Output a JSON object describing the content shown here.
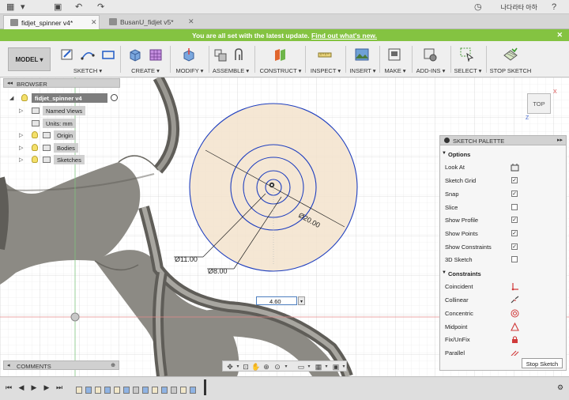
{
  "titlebar": {
    "user_name": "나다라타 아하",
    "help_label": "?"
  },
  "tabs": [
    {
      "label": "fidjet_spinner v4*",
      "active": true
    },
    {
      "label": "BusanU_fidjet v5*",
      "active": false
    }
  ],
  "notice": {
    "text": "You are all set with the latest update.",
    "link": "Find out what's new.",
    "close": "✕",
    "color": "#84c341"
  },
  "toolbar": {
    "workspace": "MODEL ▾",
    "groups": [
      "SKETCH ▾",
      "CREATE ▾",
      "MODIFY ▾",
      "ASSEMBLE ▾",
      "CONSTRUCT ▾",
      "INSPECT ▾",
      "INSERT ▾",
      "MAKE ▾",
      "ADD-INS ▾",
      "SELECT ▾",
      "STOP SKETCH"
    ]
  },
  "browser": {
    "title": "BROWSER",
    "root": "fidjet_spinner v4",
    "items": [
      "Named Views",
      "Units: mm",
      "Origin",
      "Bodies",
      "Sketches"
    ]
  },
  "comments": {
    "title": "COMMENTS"
  },
  "viewcube": {
    "face": "TOP",
    "x_axis": "X",
    "z_axis": "Z"
  },
  "dimensions": {
    "d1": "Ø11.00",
    "d2": "Ø8.00",
    "d3": "Ø20.00",
    "input_value": "4.60"
  },
  "sketch_palette": {
    "title": "SKETCH PALETTE",
    "options_title": "Options",
    "options": [
      {
        "label": "Look At",
        "control": "button"
      },
      {
        "label": "Sketch Grid",
        "control": "checkbox",
        "checked": true
      },
      {
        "label": "Snap",
        "control": "checkbox",
        "checked": true
      },
      {
        "label": "Slice",
        "control": "checkbox",
        "checked": false
      },
      {
        "label": "Show Profile",
        "control": "checkbox",
        "checked": true
      },
      {
        "label": "Show Points",
        "control": "checkbox",
        "checked": true
      },
      {
        "label": "Show Constraints",
        "control": "checkbox",
        "checked": true
      },
      {
        "label": "3D Sketch",
        "control": "checkbox",
        "checked": false
      }
    ],
    "constraints_title": "Constraints",
    "constraints": [
      "Coincident",
      "Collinear",
      "Concentric",
      "Midpoint",
      "Fix/UnFix",
      "Parallel"
    ],
    "stop_button": "Stop Sketch"
  },
  "colors": {
    "sketch_blue": "#1f3fbf",
    "profile_fill": "#f3e3cd",
    "body_gray": "#8c8a84",
    "axis_red": "#d94b4b",
    "axis_green": "#4aa64a"
  }
}
